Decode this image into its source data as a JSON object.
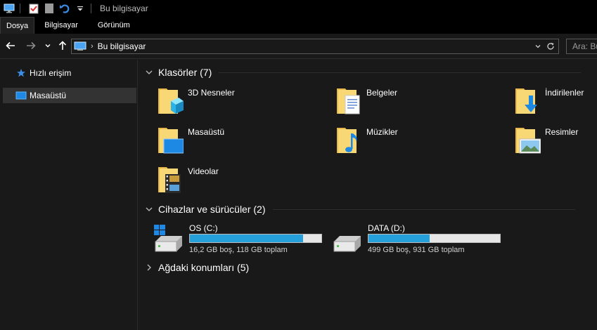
{
  "window": {
    "title": "Bu bilgisayar"
  },
  "ribbon": {
    "tabs": [
      "Dosya",
      "Bilgisayar",
      "Görünüm"
    ]
  },
  "address": {
    "crumb": "Bu bilgisayar",
    "search_placeholder": "Ara: Bu"
  },
  "sidebar": {
    "items": [
      {
        "label": "Hızlı erişim",
        "icon": "pin-star-icon",
        "selected": false
      },
      {
        "label": "Masaüstü",
        "icon": "desktop-icon",
        "selected": true
      }
    ]
  },
  "groups": {
    "folders": {
      "title": "Klasörler (7)"
    },
    "devices": {
      "title": "Cihazlar ve sürücüler (2)"
    },
    "network": {
      "title": "Ağdaki konumları (5)"
    }
  },
  "folders": [
    {
      "name": "3D Nesneler",
      "icon": "3d-objects-folder-icon"
    },
    {
      "name": "Belgeler",
      "icon": "documents-folder-icon"
    },
    {
      "name": "İndirilenler",
      "icon": "downloads-folder-icon"
    },
    {
      "name": "Masaüstü",
      "icon": "desktop-folder-icon"
    },
    {
      "name": "Müzikler",
      "icon": "music-folder-icon"
    },
    {
      "name": "Resimler",
      "icon": "pictures-folder-icon"
    },
    {
      "name": "Videolar",
      "icon": "videos-folder-icon"
    }
  ],
  "drives": [
    {
      "name": "OS (C:)",
      "info": "16,2 GB boş, 118 GB toplam",
      "used_fraction": 0.863,
      "icon": "windows-drive-icon"
    },
    {
      "name": "DATA (D:)",
      "info": "499 GB boş, 931 GB toplam",
      "used_fraction": 0.464,
      "icon": "hard-drive-icon"
    }
  ],
  "colors": {
    "background": "#191919",
    "bar_fill": "#26a0da",
    "bar_track": "#e6e6e6",
    "folder_yellow": "#f8d775",
    "accent_blue": "#1e88e5"
  }
}
